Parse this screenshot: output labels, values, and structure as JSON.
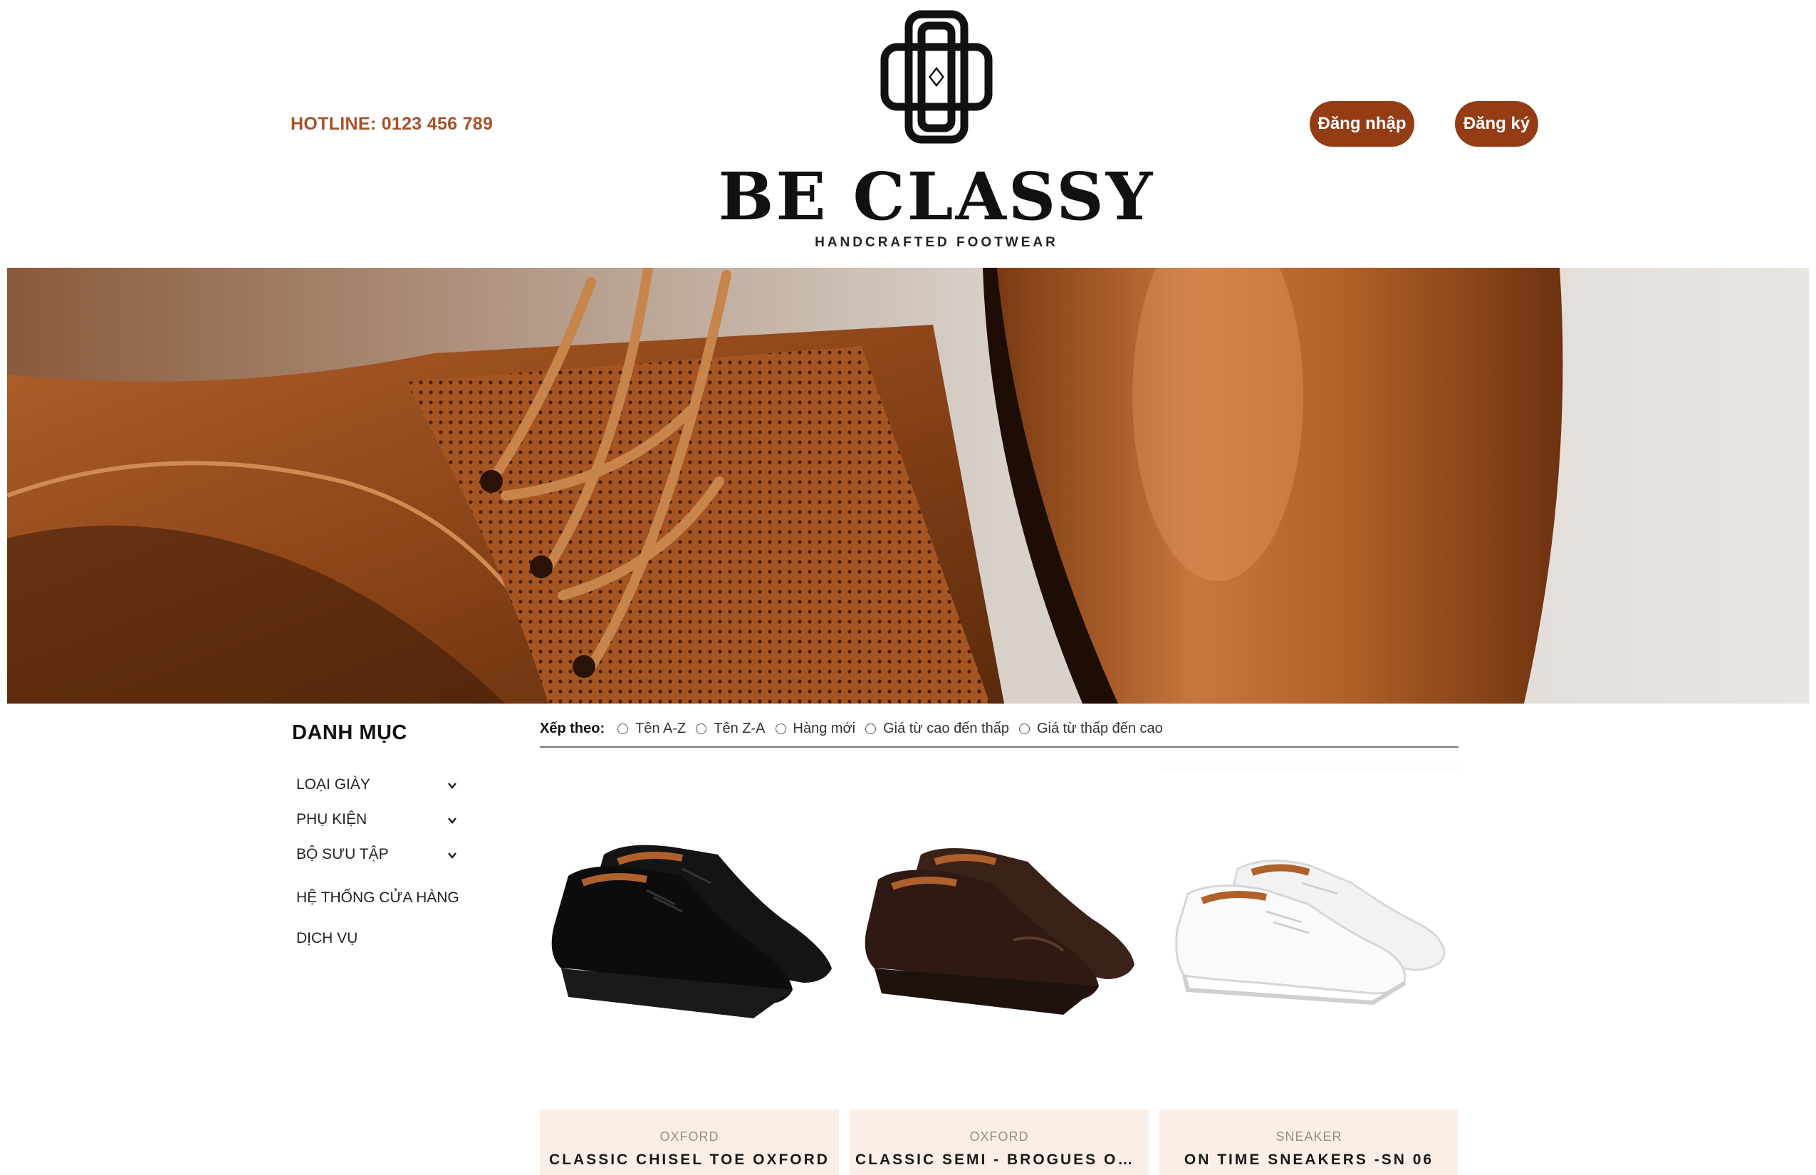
{
  "header": {
    "hotline": "HOTLINE: 0123 456 789",
    "brand_name": "BE CLASSY",
    "tagline": "HANDCRAFTED FOOTWEAR",
    "login_label": "Đăng nhập",
    "register_label": "Đăng ký"
  },
  "colors": {
    "accent": "#943c14",
    "hotline": "#a8522a",
    "card_info_bg": "#fbeee6"
  },
  "sidebar": {
    "title": "DANH MỤC",
    "items": [
      {
        "label": "LOẠI GIÀY",
        "icon": "chevron-down-icon"
      },
      {
        "label": "PHỤ KIỆN",
        "icon": "chevron-down-icon"
      },
      {
        "label": "BỘ SƯU TẬP",
        "icon": "chevron-down-icon"
      },
      {
        "label": "HỆ THỐNG CỬA HÀNG"
      },
      {
        "label": "DỊCH VỤ"
      }
    ]
  },
  "sort": {
    "label": "Xếp theo:",
    "options": [
      "Tên A-Z",
      "Tên Z-A",
      "Hàng mới",
      "Giá từ cao đến thấp",
      "Giá từ thấp đến cao"
    ]
  },
  "products": [
    {
      "category": "OXFORD",
      "name": "CLASSIC CHISEL TOE OXFORD"
    },
    {
      "category": "OXFORD",
      "name": "CLASSIC SEMI - BROGUES OXFORD"
    },
    {
      "category": "SNEAKER",
      "name": "ON TIME SNEAKERS -SN 06"
    }
  ]
}
